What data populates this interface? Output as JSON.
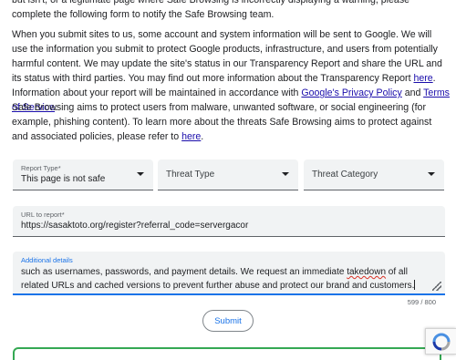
{
  "intro": {
    "p0_text": "but isn't, or a legitimate page where Safe Browsing is incorrectly displaying a warning, please complete the following form to notify the Safe Browsing team.",
    "p1_part1": "When you submit sites to us, some account and system information will be sent to Google. We will use the information you submit to protect Google products, infrastructure, and users from potentially harmful content. We may update the site's status in our Transparency Report and share the URL and its status with third parties. You may find out more information about the Transparency Report ",
    "p1_link_here": "here",
    "p1_part2": ". Information about your report will be maintained in accordance with ",
    "p1_link_privacy": "Google's Privacy Policy",
    "p1_part3": " and ",
    "p1_link_terms": "Terms of Service",
    "p1_part4": ".",
    "p2_part1": "Safe Browsing aims to protect users from malware, unwanted software, or social engineering (for example, phishing content). To learn more about the threats Safe Browsing aims to protect against and associated policies, please refer to ",
    "p2_link_here": "here",
    "p2_part2": "."
  },
  "form": {
    "report_type": {
      "label": "Report Type*",
      "value": "This page is not safe"
    },
    "threat_type": {
      "placeholder": "Threat Type"
    },
    "threat_category": {
      "placeholder": "Threat Category"
    },
    "url": {
      "label": "URL to report*",
      "value": "https://sasaktoto.org/register?referral_code=servergacor"
    },
    "details": {
      "label": "Additional details",
      "text_before": "such as usernames, passwords, and payment details. We request an immediate ",
      "misspelled_word": "takedown",
      "text_after": " of all related URLs and cached versions to prevent further abuse and protect our brand and customers."
    },
    "char_count": "599 / 800",
    "submit_label": "Submit"
  },
  "colors": {
    "accent": "#1a73e8",
    "link": "#1a0dab",
    "field_bg": "#f1f3f4",
    "success": "#34a853"
  }
}
